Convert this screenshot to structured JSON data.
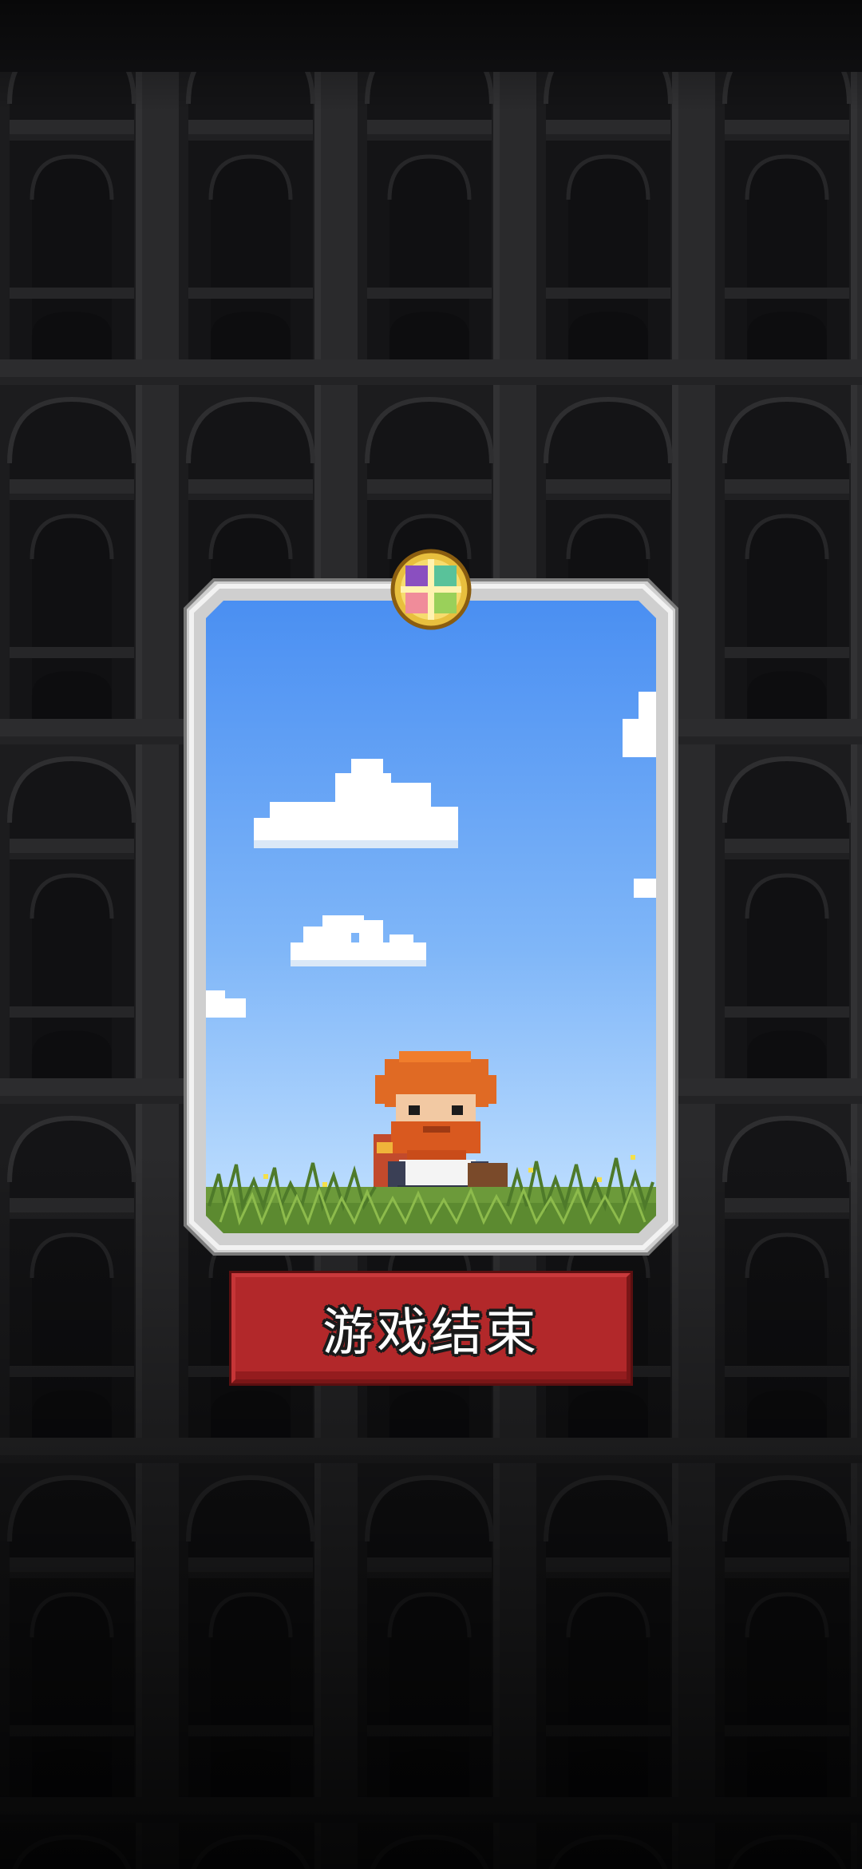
{
  "game_over_button": {
    "label": "游戏结束"
  },
  "colors": {
    "background": "#1b1b1d",
    "wall_dark": "#161618",
    "wall_mid": "#262628",
    "frame_silver": "#d9d9d9",
    "sky_top": "#4f94f3",
    "sky_bottom": "#bfe0ff",
    "grass": "#6f9a3e",
    "button_red": "#b2282a",
    "gem_gold": "#f3d35a"
  },
  "icons": {
    "background": "dark-arcade-wall-pattern",
    "emblem": "gold-medallion-icon",
    "character": "bearded-hero-sprite"
  }
}
